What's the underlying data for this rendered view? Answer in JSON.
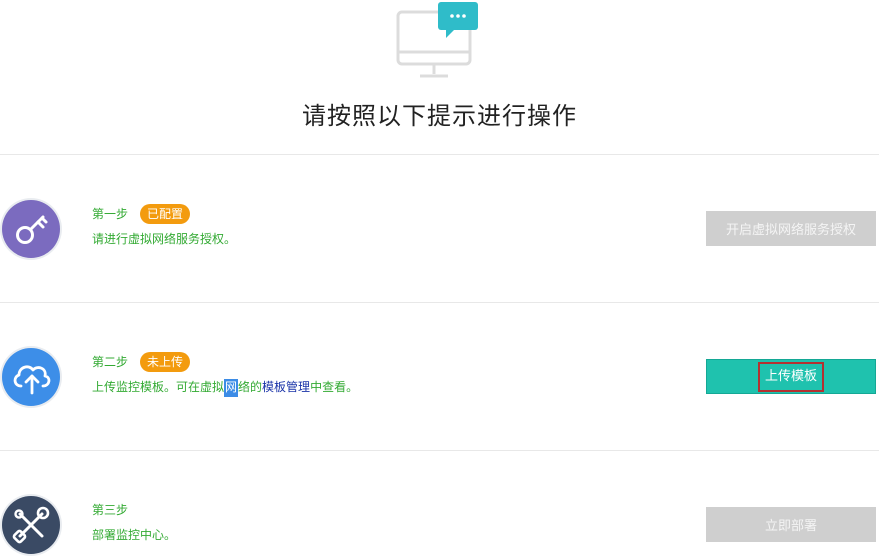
{
  "header": {
    "title": "请按照以下提示进行操作",
    "icon": "monitor-chat-icon"
  },
  "colors": {
    "step_text": "#33aa33",
    "badge": "#f39b0e",
    "primary_button": "#1fc2ae",
    "disabled_button": "#cfcfcf",
    "link": "#1a33a8"
  },
  "steps": [
    {
      "title": "第一步",
      "badge": "已配置",
      "description": "请进行虚拟网络服务授权。",
      "button": "开启虚拟网络服务授权",
      "button_state": "disabled",
      "icon": "key-icon",
      "icon_color": "#7b6bbf"
    },
    {
      "title": "第二步",
      "badge": "未上传",
      "desc_part1": "上传监控模板。可在虚拟",
      "desc_highlight": "网",
      "desc_part2": "络的",
      "desc_link": "模板管理",
      "desc_part3": "中查看。",
      "button": "上传模板",
      "button_state": "active",
      "icon": "cloud-upload-icon",
      "icon_color": "#3d8ee8"
    },
    {
      "title": "第三步",
      "description": "部署监控中心。",
      "button": "立即部署",
      "button_state": "disabled",
      "icon": "tools-icon",
      "icon_color": "#3a4a64"
    }
  ]
}
